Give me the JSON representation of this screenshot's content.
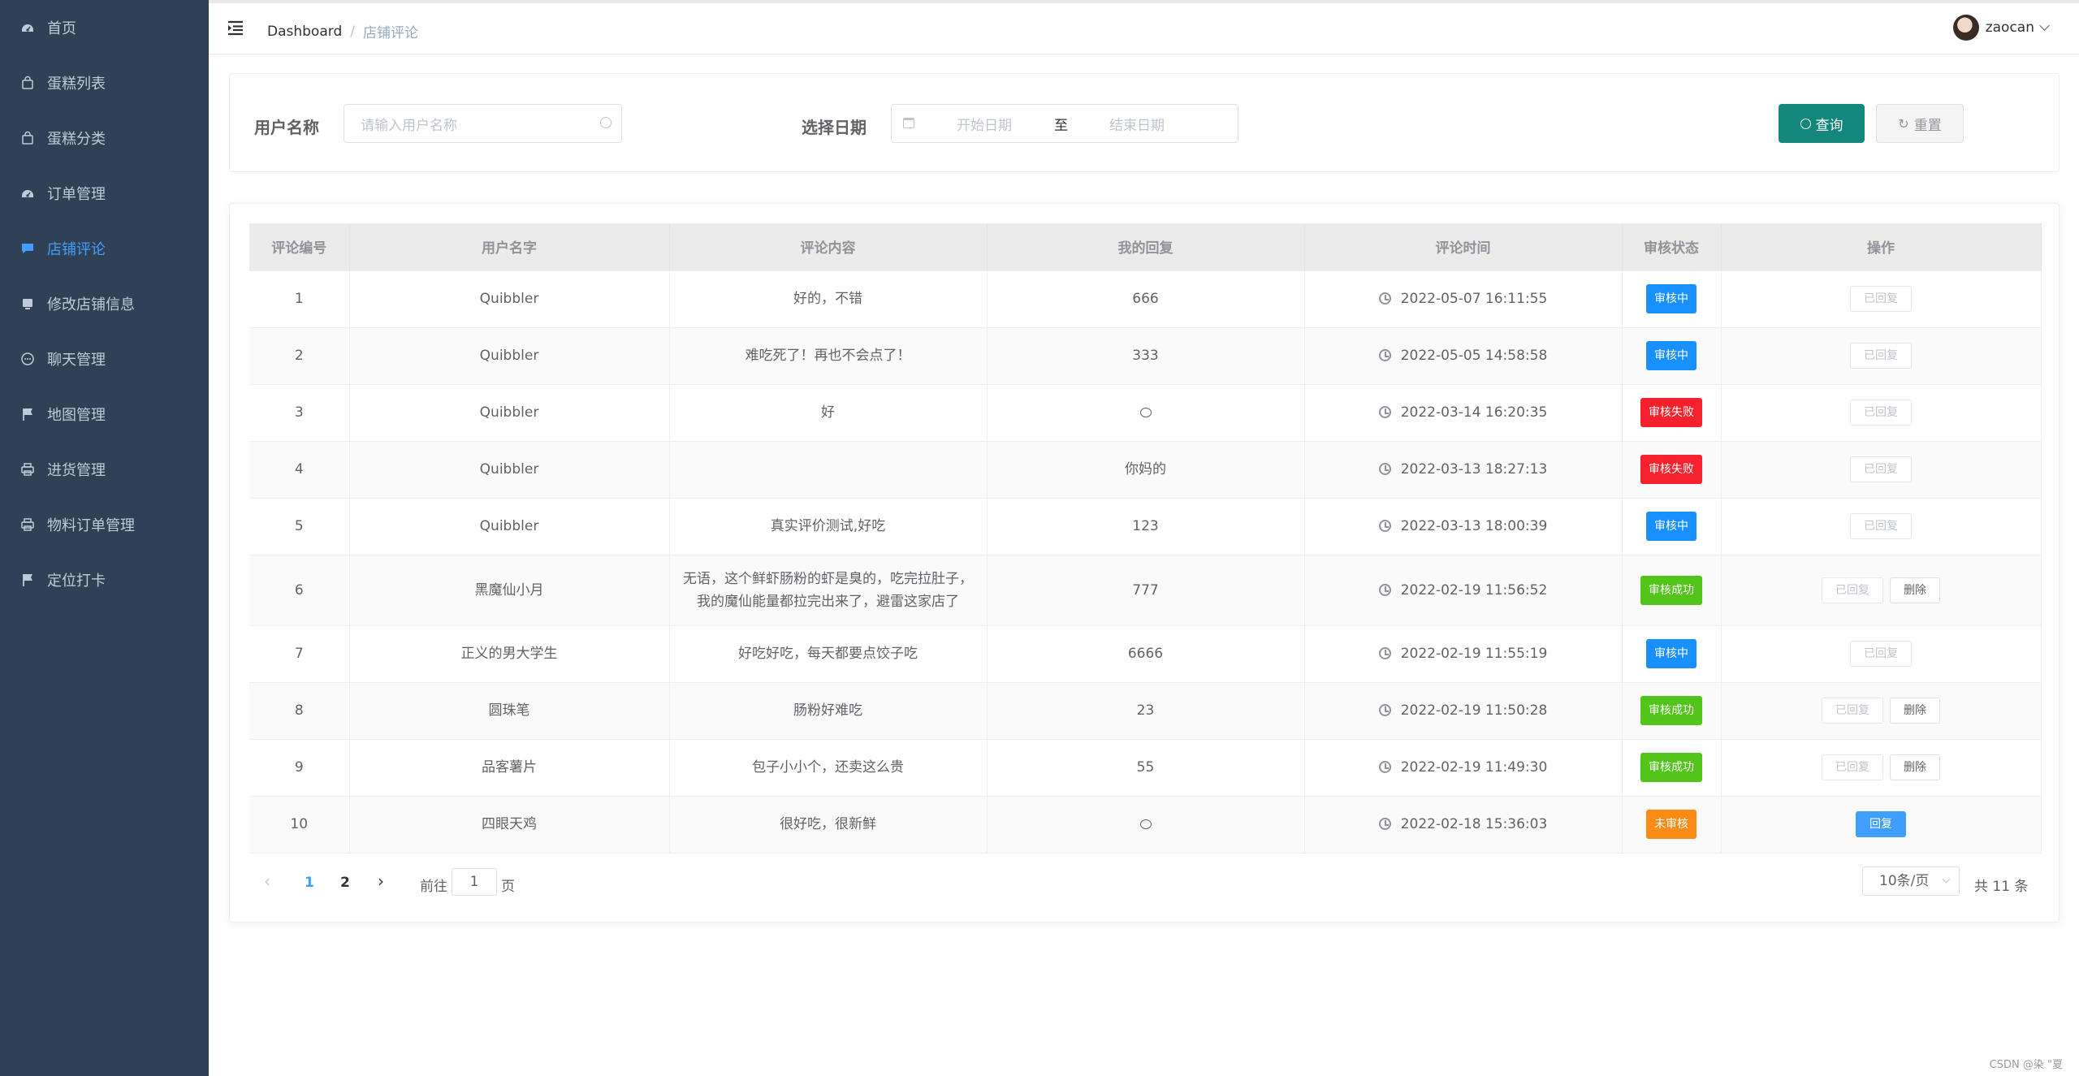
{
  "sidebar": {
    "items": [
      {
        "label": "首页",
        "icon": "dashboard-icon",
        "active": false
      },
      {
        "label": "蛋糕列表",
        "icon": "shopping-bag-icon",
        "active": false
      },
      {
        "label": "蛋糕分类",
        "icon": "shopping-bag-icon",
        "active": false
      },
      {
        "label": "订单管理",
        "icon": "dashboard-icon",
        "active": false
      },
      {
        "label": "店铺评论",
        "icon": "message-icon",
        "active": true
      },
      {
        "label": "修改店铺信息",
        "icon": "store-icon",
        "active": false
      },
      {
        "label": "聊天管理",
        "icon": "chat-icon",
        "active": false
      },
      {
        "label": "地图管理",
        "icon": "flag-icon",
        "active": false
      },
      {
        "label": "进货管理",
        "icon": "printer-icon",
        "active": false
      },
      {
        "label": "物料订单管理",
        "icon": "printer-icon",
        "active": false
      },
      {
        "label": "定位打卡",
        "icon": "flag-icon",
        "active": false
      }
    ]
  },
  "header": {
    "breadcrumb_home": "Dashboard",
    "breadcrumb_sep": "/",
    "breadcrumb_current": "店铺评论",
    "username": "zaocan"
  },
  "filter": {
    "user_label": "用户名称",
    "user_placeholder": "请输入用户名称",
    "date_label": "选择日期",
    "start_placeholder": "开始日期",
    "range_sep": "至",
    "end_placeholder": "结束日期",
    "search_label": "查询",
    "reset_label": "重置"
  },
  "table": {
    "headers": [
      "评论编号",
      "用户名字",
      "评论内容",
      "我的回复",
      "评论时间",
      "审核状态",
      "操作"
    ],
    "rows": [
      {
        "id": "1",
        "user": "Quibbler",
        "content": "好的，不错",
        "reply": "666",
        "time": "2022-05-07 16:11:55",
        "status": "审核中",
        "status_color": "#1890ff",
        "actions": [
          "已回复"
        ]
      },
      {
        "id": "2",
        "user": "Quibbler",
        "content": "难吃死了！再也不会点了！",
        "reply": "333",
        "time": "2022-05-05 14:58:58",
        "status": "审核中",
        "status_color": "#1890ff",
        "actions": [
          "已回复"
        ]
      },
      {
        "id": "3",
        "user": "Quibbler",
        "content": "好",
        "reply": "",
        "reply_icon": "chat-icon",
        "time": "2022-03-14 16:20:35",
        "status": "审核失败",
        "status_color": "#f5222d",
        "actions": [
          "已回复"
        ]
      },
      {
        "id": "4",
        "user": "Quibbler",
        "content": "",
        "reply": "你妈的",
        "time": "2022-03-13 18:27:13",
        "status": "审核失败",
        "status_color": "#f5222d",
        "actions": [
          "已回复"
        ]
      },
      {
        "id": "5",
        "user": "Quibbler",
        "content": "真实评价测试,好吃",
        "reply": "123",
        "time": "2022-03-13 18:00:39",
        "status": "审核中",
        "status_color": "#1890ff",
        "actions": [
          "已回复"
        ]
      },
      {
        "id": "6",
        "user": "黑魔仙小月",
        "content": "无语，这个鲜虾肠粉的虾是臭的，吃完拉肚子，我的魔仙能量都拉完出来了，避雷这家店了",
        "content_line1": "无语，这个鲜虾肠粉的虾是臭的，吃完拉肚子，",
        "content_line2": "我的魔仙能量都拉完出来了，避雷这家店了",
        "reply": "777",
        "time": "2022-02-19 11:56:52",
        "status": "审核成功",
        "status_color": "#52c41a",
        "actions": [
          "已回复",
          "删除"
        ]
      },
      {
        "id": "7",
        "user": "正义的男大学生",
        "content": "好吃好吃，每天都要点饺子吃",
        "reply": "6666",
        "time": "2022-02-19 11:55:19",
        "status": "审核中",
        "status_color": "#1890ff",
        "actions": [
          "已回复"
        ]
      },
      {
        "id": "8",
        "user": "圆珠笔",
        "content": "肠粉好难吃",
        "reply": "23",
        "time": "2022-02-19 11:50:28",
        "status": "审核成功",
        "status_color": "#52c41a",
        "actions": [
          "已回复",
          "删除"
        ]
      },
      {
        "id": "9",
        "user": "品客薯片",
        "content": "包子小小个，还卖这么贵",
        "reply": "55",
        "time": "2022-02-19 11:49:30",
        "status": "审核成功",
        "status_color": "#52c41a",
        "actions": [
          "已回复",
          "删除"
        ]
      },
      {
        "id": "10",
        "user": "四眼天鸡",
        "content": "很好吃，很新鲜",
        "reply": "",
        "reply_icon": "chat-icon",
        "time": "2022-02-18 15:36:03",
        "status": "未审核",
        "status_color": "#fa8c16",
        "actions": [
          "回复"
        ]
      }
    ]
  },
  "pagination": {
    "prev": "‹",
    "pages": [
      "1",
      "2"
    ],
    "current_page": "1",
    "next": "›",
    "goto_label": "前往",
    "goto_value": "1",
    "page_unit": "页",
    "page_size": "10条/页",
    "total": "共 11 条"
  },
  "footer": {
    "watermark": "CSDN @染 \"夏"
  }
}
